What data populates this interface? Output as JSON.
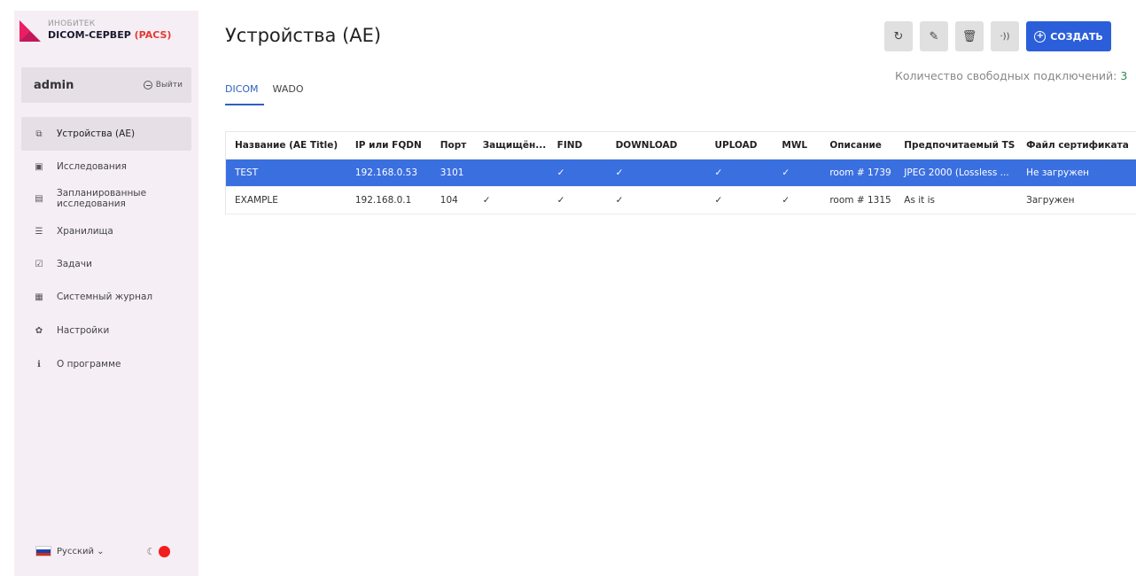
{
  "brand": {
    "small": "ИНОБИТЕК",
    "name": "DICOM-СЕРВЕР",
    "suffix": "(PACS)",
    "logo_color": "#c2185b"
  },
  "user": {
    "name": "admin",
    "logout_label": "Выйти"
  },
  "sidebar": {
    "items": [
      {
        "label": "Устройства (AE)",
        "icon": "devices-icon",
        "active": true
      },
      {
        "label": "Исследования",
        "icon": "studies-icon"
      },
      {
        "label": "Запланированные исследования",
        "icon": "scheduled-icon"
      },
      {
        "label": "Хранилища",
        "icon": "storage-icon"
      },
      {
        "label": "Задачи",
        "icon": "tasks-icon"
      },
      {
        "label": "Системный журнал",
        "icon": "log-icon"
      },
      {
        "label": "Настройки",
        "icon": "gear-icon"
      },
      {
        "label": "О программе",
        "icon": "info-icon"
      }
    ],
    "language": "Русский"
  },
  "page": {
    "title": "Устройства (AE)",
    "tabs": [
      "DICOM",
      "WADO"
    ],
    "active_tab": "DICOM",
    "free_connections_label": "Количество свободных подключений:",
    "free_connections_value": "3"
  },
  "toolbar": {
    "create_label": "СОЗДАТЬ",
    "accent": "#2b5fd9"
  },
  "table": {
    "columns": [
      "Название (AE Title)",
      "IP или FQDN",
      "Порт",
      "Защищён...",
      "FIND",
      "DOWNLOAD",
      "UPLOAD",
      "MWL",
      "Описание",
      "Предпочитаемый TS",
      "Файл сертификата"
    ],
    "rows": [
      [
        "TEST",
        "192.168.0.53",
        "3101",
        "",
        "✓",
        "✓",
        "✓",
        "✓",
        "room # 1739",
        "JPEG 2000 (Lossless ...",
        "Не загружен"
      ],
      [
        "EXAMPLE",
        "192.168.0.1",
        "104",
        "✓",
        "✓",
        "✓",
        "✓",
        "✓",
        "room # 1315",
        "As it is",
        "Загружен"
      ]
    ],
    "selected_row": 0,
    "selected_color": "#3a6fe0"
  }
}
